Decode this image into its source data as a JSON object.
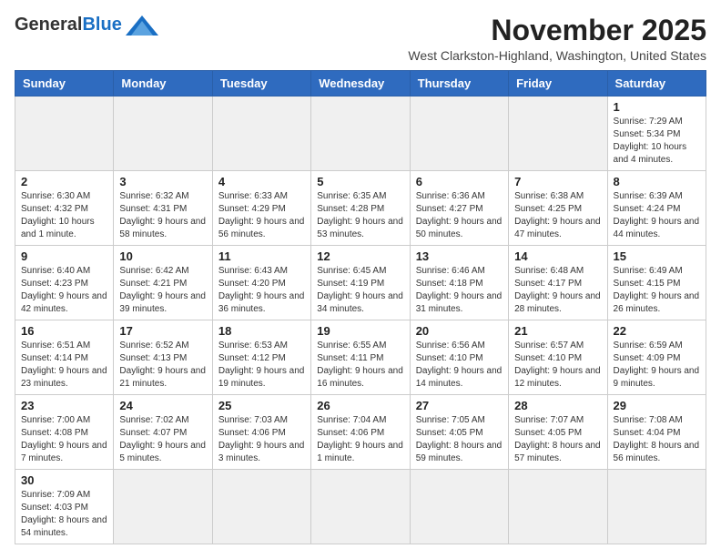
{
  "header": {
    "logo_general": "General",
    "logo_blue": "Blue",
    "month_title": "November 2025",
    "subtitle": "West Clarkston-Highland, Washington, United States"
  },
  "weekdays": [
    "Sunday",
    "Monday",
    "Tuesday",
    "Wednesday",
    "Thursday",
    "Friday",
    "Saturday"
  ],
  "weeks": [
    [
      {
        "day": "",
        "info": ""
      },
      {
        "day": "",
        "info": ""
      },
      {
        "day": "",
        "info": ""
      },
      {
        "day": "",
        "info": ""
      },
      {
        "day": "",
        "info": ""
      },
      {
        "day": "",
        "info": ""
      },
      {
        "day": "1",
        "info": "Sunrise: 7:29 AM\nSunset: 5:34 PM\nDaylight: 10 hours and 4 minutes."
      }
    ],
    [
      {
        "day": "2",
        "info": "Sunrise: 6:30 AM\nSunset: 4:32 PM\nDaylight: 10 hours and 1 minute."
      },
      {
        "day": "3",
        "info": "Sunrise: 6:32 AM\nSunset: 4:31 PM\nDaylight: 9 hours and 58 minutes."
      },
      {
        "day": "4",
        "info": "Sunrise: 6:33 AM\nSunset: 4:29 PM\nDaylight: 9 hours and 56 minutes."
      },
      {
        "day": "5",
        "info": "Sunrise: 6:35 AM\nSunset: 4:28 PM\nDaylight: 9 hours and 53 minutes."
      },
      {
        "day": "6",
        "info": "Sunrise: 6:36 AM\nSunset: 4:27 PM\nDaylight: 9 hours and 50 minutes."
      },
      {
        "day": "7",
        "info": "Sunrise: 6:38 AM\nSunset: 4:25 PM\nDaylight: 9 hours and 47 minutes."
      },
      {
        "day": "8",
        "info": "Sunrise: 6:39 AM\nSunset: 4:24 PM\nDaylight: 9 hours and 44 minutes."
      }
    ],
    [
      {
        "day": "9",
        "info": "Sunrise: 6:40 AM\nSunset: 4:23 PM\nDaylight: 9 hours and 42 minutes."
      },
      {
        "day": "10",
        "info": "Sunrise: 6:42 AM\nSunset: 4:21 PM\nDaylight: 9 hours and 39 minutes."
      },
      {
        "day": "11",
        "info": "Sunrise: 6:43 AM\nSunset: 4:20 PM\nDaylight: 9 hours and 36 minutes."
      },
      {
        "day": "12",
        "info": "Sunrise: 6:45 AM\nSunset: 4:19 PM\nDaylight: 9 hours and 34 minutes."
      },
      {
        "day": "13",
        "info": "Sunrise: 6:46 AM\nSunset: 4:18 PM\nDaylight: 9 hours and 31 minutes."
      },
      {
        "day": "14",
        "info": "Sunrise: 6:48 AM\nSunset: 4:17 PM\nDaylight: 9 hours and 28 minutes."
      },
      {
        "day": "15",
        "info": "Sunrise: 6:49 AM\nSunset: 4:15 PM\nDaylight: 9 hours and 26 minutes."
      }
    ],
    [
      {
        "day": "16",
        "info": "Sunrise: 6:51 AM\nSunset: 4:14 PM\nDaylight: 9 hours and 23 minutes."
      },
      {
        "day": "17",
        "info": "Sunrise: 6:52 AM\nSunset: 4:13 PM\nDaylight: 9 hours and 21 minutes."
      },
      {
        "day": "18",
        "info": "Sunrise: 6:53 AM\nSunset: 4:12 PM\nDaylight: 9 hours and 19 minutes."
      },
      {
        "day": "19",
        "info": "Sunrise: 6:55 AM\nSunset: 4:11 PM\nDaylight: 9 hours and 16 minutes."
      },
      {
        "day": "20",
        "info": "Sunrise: 6:56 AM\nSunset: 4:10 PM\nDaylight: 9 hours and 14 minutes."
      },
      {
        "day": "21",
        "info": "Sunrise: 6:57 AM\nSunset: 4:10 PM\nDaylight: 9 hours and 12 minutes."
      },
      {
        "day": "22",
        "info": "Sunrise: 6:59 AM\nSunset: 4:09 PM\nDaylight: 9 hours and 9 minutes."
      }
    ],
    [
      {
        "day": "23",
        "info": "Sunrise: 7:00 AM\nSunset: 4:08 PM\nDaylight: 9 hours and 7 minutes."
      },
      {
        "day": "24",
        "info": "Sunrise: 7:02 AM\nSunset: 4:07 PM\nDaylight: 9 hours and 5 minutes."
      },
      {
        "day": "25",
        "info": "Sunrise: 7:03 AM\nSunset: 4:06 PM\nDaylight: 9 hours and 3 minutes."
      },
      {
        "day": "26",
        "info": "Sunrise: 7:04 AM\nSunset: 4:06 PM\nDaylight: 9 hours and 1 minute."
      },
      {
        "day": "27",
        "info": "Sunrise: 7:05 AM\nSunset: 4:05 PM\nDaylight: 8 hours and 59 minutes."
      },
      {
        "day": "28",
        "info": "Sunrise: 7:07 AM\nSunset: 4:05 PM\nDaylight: 8 hours and 57 minutes."
      },
      {
        "day": "29",
        "info": "Sunrise: 7:08 AM\nSunset: 4:04 PM\nDaylight: 8 hours and 56 minutes."
      }
    ],
    [
      {
        "day": "30",
        "info": "Sunrise: 7:09 AM\nSunset: 4:03 PM\nDaylight: 8 hours and 54 minutes."
      },
      {
        "day": "",
        "info": ""
      },
      {
        "day": "",
        "info": ""
      },
      {
        "day": "",
        "info": ""
      },
      {
        "day": "",
        "info": ""
      },
      {
        "day": "",
        "info": ""
      },
      {
        "day": "",
        "info": ""
      }
    ]
  ]
}
